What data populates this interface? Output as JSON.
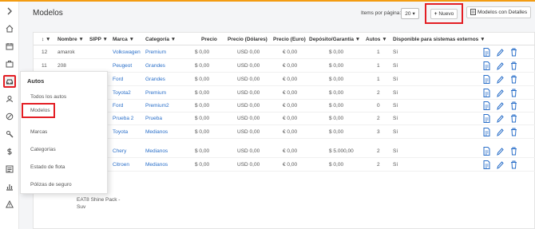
{
  "page": {
    "title": "Modelos"
  },
  "toolbar": {
    "items_per_page_label": "Items por página:",
    "items_per_page_value": "20",
    "new_label": "Nuevo",
    "details_label": "Modelos con Detalles"
  },
  "table": {
    "headers": [
      "Nombre",
      "SIPP",
      "Marca",
      "Categoría",
      "Precio",
      "Precio (Dólares)",
      "Precio (Euro)",
      "Depósito/Garantía",
      "Autos",
      "Disponible para sistemas externos"
    ],
    "rows": [
      {
        "id": "12",
        "name": "amarok",
        "brand": "Volkswagen",
        "category": "Premium",
        "price": "$ 0,00",
        "usd": "USD 0,00",
        "eur": "€ 0,00",
        "deposit": "$ 0,00",
        "cars": "1",
        "avail": "Sí"
      },
      {
        "id": "11",
        "name": "208",
        "brand": "Peugeot",
        "category": "Grandes",
        "price": "$ 0,00",
        "usd": "USD 0,00",
        "eur": "€ 0,00",
        "deposit": "$ 0,00",
        "cars": "1",
        "avail": "Sí"
      },
      {
        "id": "",
        "name": "",
        "brand": "Ford",
        "category": "Grandes",
        "price": "$ 0,00",
        "usd": "USD 0,00",
        "eur": "€ 0,00",
        "deposit": "$ 0,00",
        "cars": "1",
        "avail": "Sí"
      },
      {
        "id": "",
        "name": "",
        "brand": "Toyota2",
        "category": "Premium",
        "price": "$ 0,00",
        "usd": "USD 0,00",
        "eur": "€ 0,00",
        "deposit": "$ 0,00",
        "cars": "2",
        "avail": "Sí"
      },
      {
        "id": "",
        "name": "",
        "brand": "Ford",
        "category": "Premium2",
        "price": "$ 0,00",
        "usd": "USD 0,00",
        "eur": "€ 0,00",
        "deposit": "$ 0,00",
        "cars": "0",
        "avail": "Sí"
      },
      {
        "id": "",
        "name": "",
        "brand": "Prueba 2",
        "category": "Prueba",
        "price": "$ 0,00",
        "usd": "USD 0,00",
        "eur": "€ 0,00",
        "deposit": "$ 0,00",
        "cars": "2",
        "avail": "Sí"
      },
      {
        "id": "",
        "name": "",
        "brand": "Toyota",
        "category": "Medianos",
        "price": "$ 0,00",
        "usd": "USD 0,00",
        "eur": "€ 0,00",
        "deposit": "$ 0,00",
        "cars": "3",
        "avail": "Sí"
      },
      {
        "id": "",
        "name": "",
        "brand": "Chery",
        "category": "Medianos",
        "price": "$ 0,00",
        "usd": "USD 0,00",
        "eur": "€ 0,00",
        "deposit": "$ 5.000,00",
        "cars": "2",
        "avail": "Sí"
      },
      {
        "id": "",
        "name": "",
        "brand": "Citroen",
        "category": "Medianos",
        "price": "$ 0,00",
        "usd": "USD 0,00",
        "eur": "€ 0,00",
        "deposit": "$ 0,00",
        "cars": "2",
        "avail": "Sí"
      }
    ],
    "partial_name": "EAT8 Shine Pack - Suv"
  },
  "flyout": {
    "title": "Autos",
    "items": [
      "Todos los autos",
      "Modelos",
      "Marcas",
      "Categorías",
      "Estado de flota",
      "Pólizas de seguro"
    ]
  },
  "icons": [
    "chevron-right-icon",
    "home-icon",
    "calendar-icon",
    "briefcase-icon",
    "car-icon",
    "user-icon",
    "ban-icon",
    "tools-icon",
    "dollar-icon",
    "report-icon",
    "chart-icon",
    "warning-icon"
  ],
  "colors": {
    "accent": "#f39c12",
    "highlight": "#e31e24",
    "link": "#2a6fc9",
    "chat": "#f7931e"
  }
}
